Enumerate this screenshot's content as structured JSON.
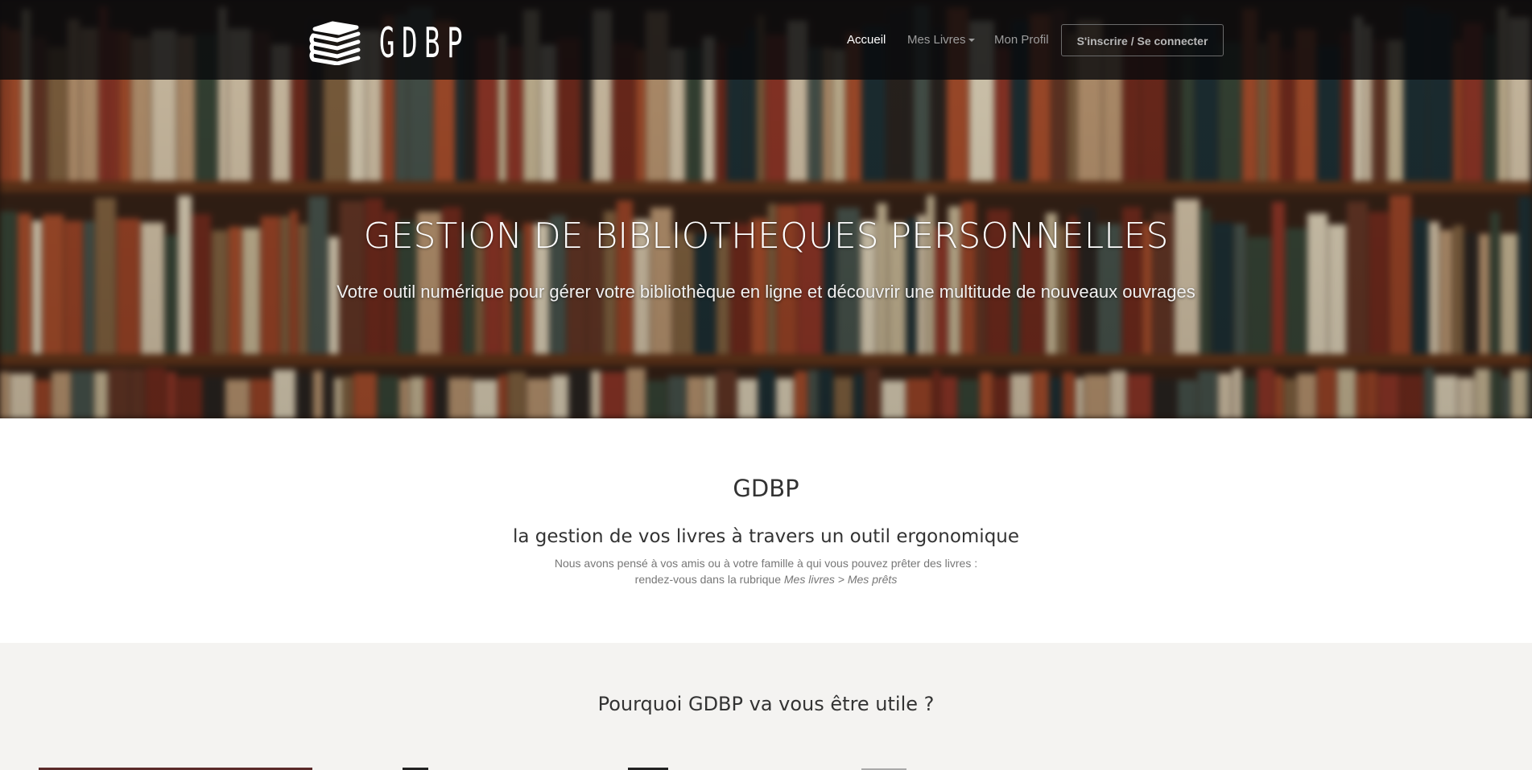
{
  "navbar": {
    "brand": "GDBP",
    "links": [
      {
        "label": "Accueil",
        "active": true
      },
      {
        "label": "Mes Livres",
        "dropdown": true
      },
      {
        "label": "Mon Profil"
      }
    ],
    "auth_button": "S'inscrire / Se connecter"
  },
  "hero": {
    "title": "GESTION DE BIBLIOTHEQUES PERSONNELLES",
    "subtitle": "Votre outil numérique pour gérer votre bibliothèque en ligne et découvrir une multitude de nouveaux ouvrages"
  },
  "intro": {
    "title": "GDBP",
    "lead": "la gestion de vos livres à travers un outil ergonomique",
    "text_line1": "Nous avons pensé à vos amis ou à votre famille à qui vous pouvez prêter des livres :",
    "text_line2_prefix": "rendez-vous dans la rubrique ",
    "text_line2_em": "Mes livres > Mes prêts"
  },
  "why": {
    "title": "Pourquoi GDBP va vous être utile ?"
  },
  "colors": {
    "navbar_bg": "#080a0c",
    "section_alt_bg": "#f4f3f1",
    "nav_link": "#9d9d9d",
    "nav_link_active": "#ffffff"
  }
}
